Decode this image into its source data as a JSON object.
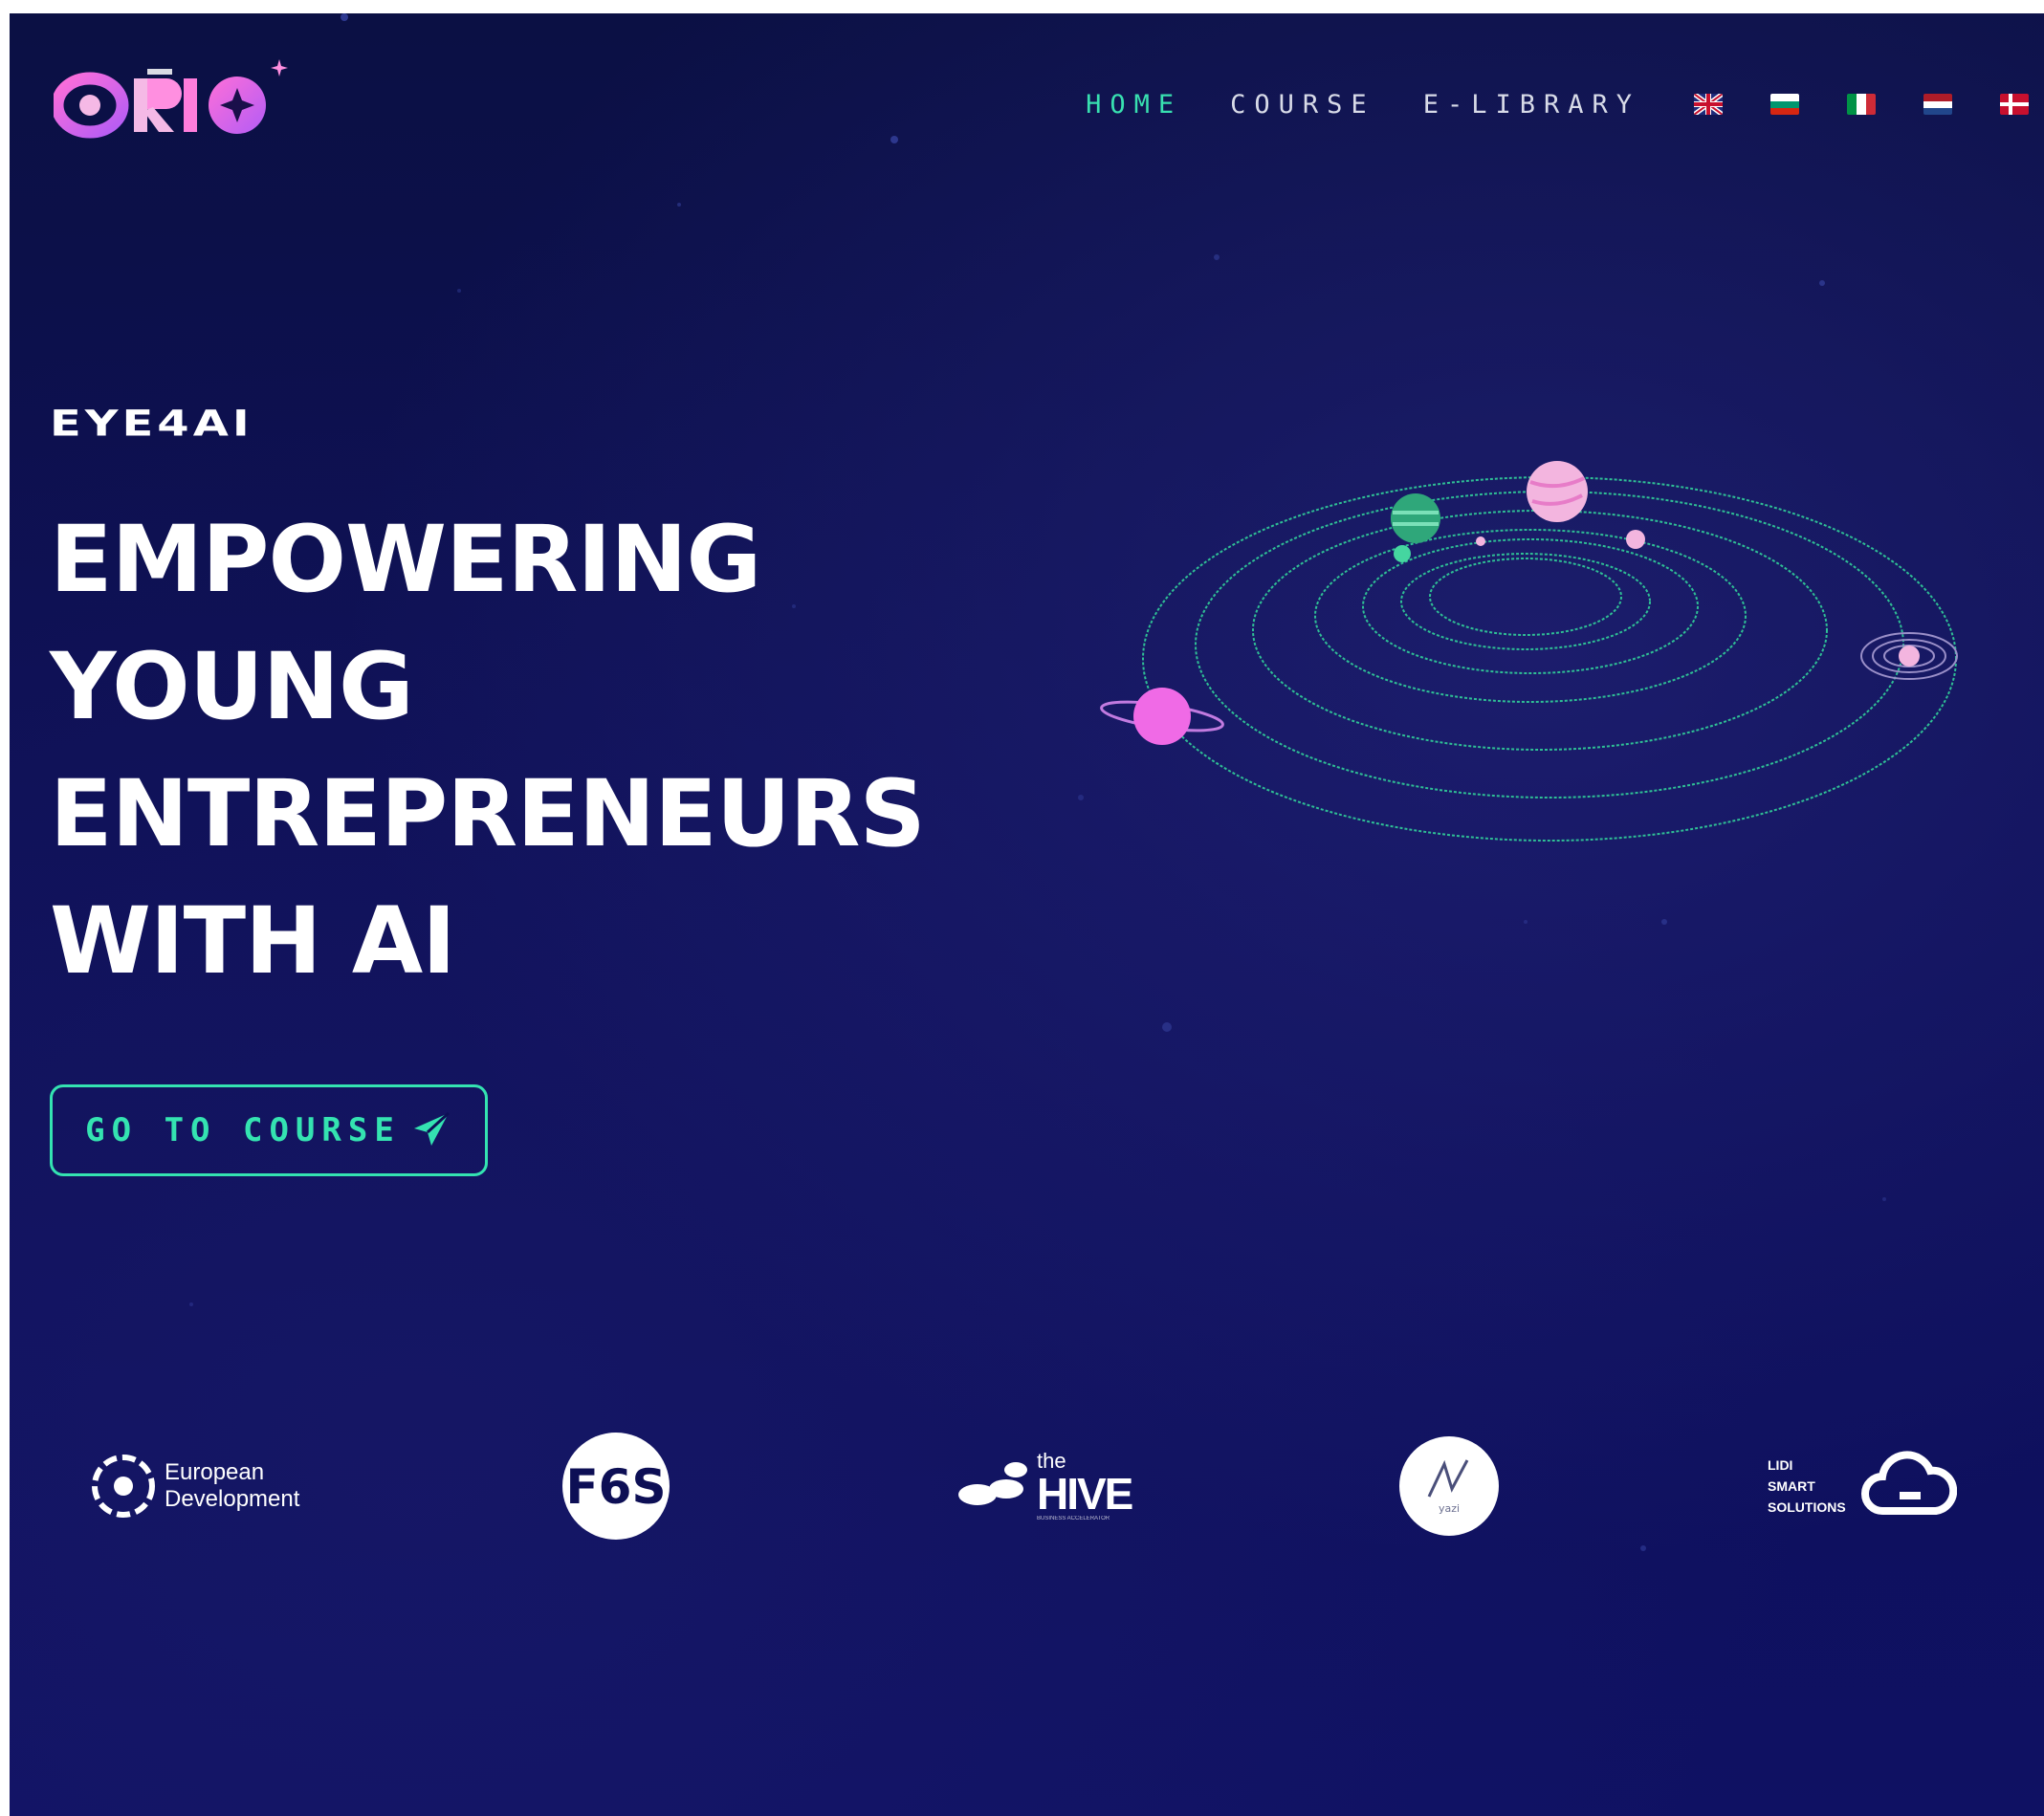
{
  "header": {
    "logo_alt": "ORIO",
    "nav": [
      {
        "label": "HOME",
        "active": true
      },
      {
        "label": "COURSE",
        "active": false
      },
      {
        "label": "E-LIBRARY",
        "active": false
      }
    ],
    "flags": [
      "flag-uk-icon",
      "flag-bulgaria-icon",
      "flag-italy-icon",
      "flag-netherlands-icon",
      "flag-denmark-icon"
    ]
  },
  "hero": {
    "brand": "EYE4AI",
    "headline": [
      "EMPOWERING",
      "YOUNG",
      "ENTREPRENEURS",
      "WITH AI"
    ],
    "cta_label": "GO TO COURSE"
  },
  "partners": [
    {
      "name": "European Development",
      "lines": [
        "European",
        "Development"
      ]
    },
    {
      "name": "F6S",
      "text": "F6S"
    },
    {
      "name": "the HIVE",
      "text_small": "the",
      "text_big": "HIVE",
      "tagline": "BUSINESS ACCELERATOR"
    },
    {
      "name": "yazi",
      "text": "yazi"
    },
    {
      "name": "LIDI Smart Solutions",
      "lines": [
        "LIDI",
        "SMART",
        "SOLUTIONS"
      ]
    }
  ],
  "colors": {
    "background": "#0d0f55",
    "accent": "#34e3b1",
    "orbit": "#2fbf95",
    "planet_pink": "#f06ae6",
    "planet_light": "#f3b5df",
    "planet_green": "#2fa77a"
  }
}
